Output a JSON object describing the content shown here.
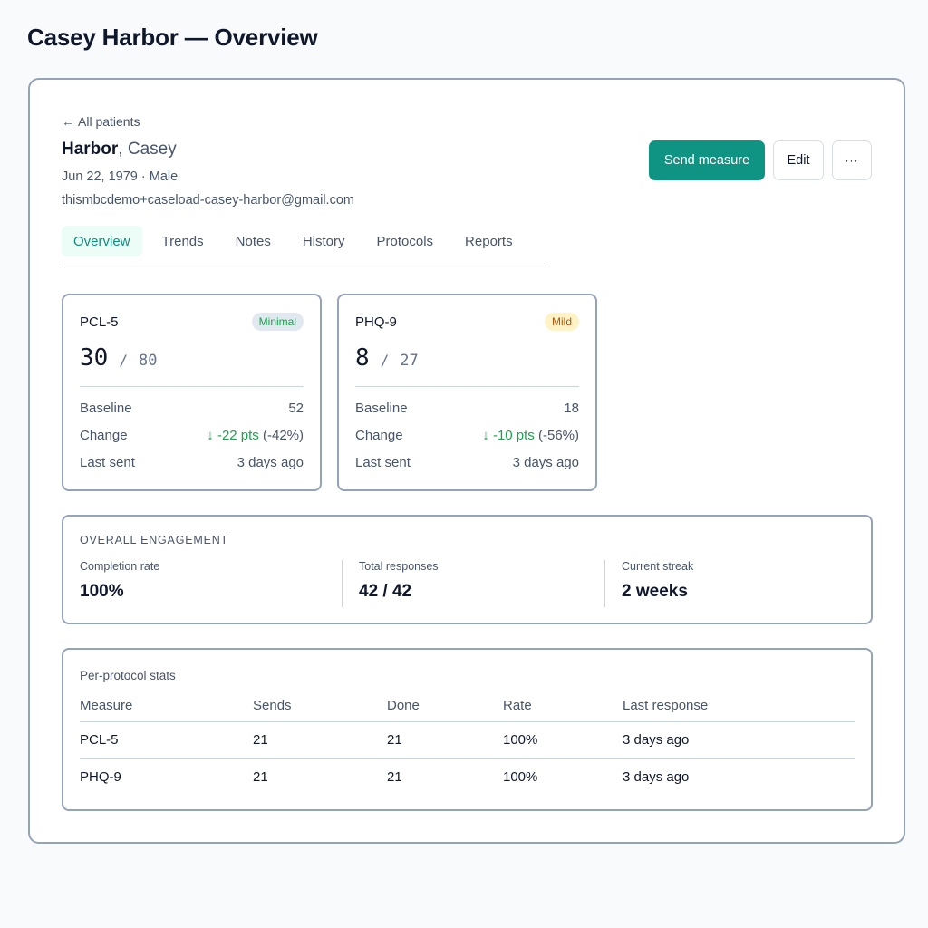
{
  "page": {
    "title": "Casey Harbor — Overview"
  },
  "patient": {
    "back_label": "All patients",
    "last_name": "Harbor",
    "first_name": ", Casey",
    "meta": "Jun 22, 1979 · Male",
    "email": "thismbcdemo+caseload-casey-harbor@gmail.com"
  },
  "actions": {
    "send_label": "Send measure",
    "edit_label": "Edit",
    "more_label": "···"
  },
  "tabs": [
    {
      "label": "Overview",
      "active": true
    },
    {
      "label": "Trends"
    },
    {
      "label": "Notes"
    },
    {
      "label": "History"
    },
    {
      "label": "Protocols"
    },
    {
      "label": "Reports"
    }
  ],
  "measures": [
    {
      "name": "PCL-5",
      "badge": "Minimal",
      "score": "30",
      "slash": "/",
      "max": "80",
      "baseline_label": "Baseline",
      "baseline": "52",
      "change_label": "Change",
      "change": "↓ -22 pts",
      "change_pct": " (-42%)",
      "last_sent_label": "Last sent",
      "last_sent": "3 days ago"
    },
    {
      "name": "PHQ-9",
      "badge": "Mild",
      "score": "8",
      "slash": "/",
      "max": "27",
      "baseline_label": "Baseline",
      "baseline": "18",
      "change_label": "Change",
      "change": "↓ -10 pts",
      "change_pct": " (-56%)",
      "last_sent_label": "Last sent",
      "last_sent": "3 days ago"
    }
  ],
  "engagement": {
    "title": "OVERALL ENGAGEMENT",
    "stats": [
      {
        "label": "Completion rate",
        "value": "100%"
      },
      {
        "label": "Total responses",
        "value": "42 / 42"
      },
      {
        "label": "Current streak",
        "value": "2 weeks"
      }
    ]
  },
  "protocol_stats": {
    "title": "Per-protocol stats",
    "columns": [
      "Measure",
      "Sends",
      "Done",
      "Rate",
      "Last response"
    ],
    "rows": [
      [
        "PCL-5",
        "21",
        "21",
        "100%",
        "3 days ago"
      ],
      [
        "PHQ-9",
        "21",
        "21",
        "100%",
        "3 days ago"
      ]
    ]
  },
  "colors": {
    "accent": "#0f9484",
    "positive": "#16a34a",
    "warning": "#b45309"
  }
}
